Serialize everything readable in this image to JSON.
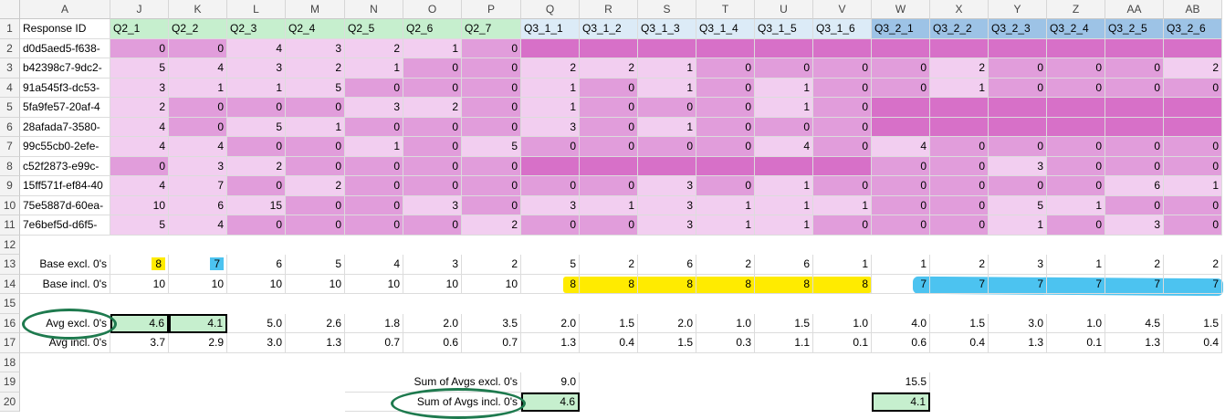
{
  "colors": {
    "q2_header": "#c6efce",
    "q31_header": "#dcebf7",
    "q32_header": "#9dc3e6",
    "light": "#f2cef0",
    "mid": "#e19ddb",
    "dark": "#d770c8",
    "yellow": "#ffeb00",
    "blue": "#4cc3f0",
    "green_fill": "#c6efce",
    "oval": "#1e7a4e"
  },
  "column_letters": [
    "A",
    "J",
    "K",
    "L",
    "M",
    "N",
    "O",
    "P",
    "Q",
    "R",
    "S",
    "T",
    "U",
    "V",
    "W",
    "X",
    "Y",
    "Z",
    "AA",
    "AB"
  ],
  "header_row": [
    "Response ID",
    "Q2_1",
    "Q2_2",
    "Q2_3",
    "Q2_4",
    "Q2_5",
    "Q2_6",
    "Q2_7",
    "Q3_1_1",
    "Q3_1_2",
    "Q3_1_3",
    "Q3_1_4",
    "Q3_1_5",
    "Q3_1_6",
    "Q3_2_1",
    "Q3_2_2",
    "Q3_2_3",
    "Q3_2_4",
    "Q3_2_5",
    "Q3_2_6"
  ],
  "data_rows": [
    {
      "id": "d0d5aed5-f638-",
      "vals": [
        "0",
        "0",
        "4",
        "3",
        "2",
        "1",
        "0",
        "",
        "",
        "",
        "",
        "",
        "",
        "",
        "",
        "",
        "",
        "",
        ""
      ]
    },
    {
      "id": "b42398c7-9dc2-",
      "vals": [
        "5",
        "4",
        "3",
        "2",
        "1",
        "0",
        "0",
        "2",
        "2",
        "1",
        "0",
        "0",
        "0",
        "0",
        "2",
        "0",
        "0",
        "0",
        "2"
      ]
    },
    {
      "id": "91a545f3-dc53-",
      "vals": [
        "3",
        "1",
        "1",
        "5",
        "0",
        "0",
        "0",
        "1",
        "0",
        "1",
        "0",
        "1",
        "0",
        "0",
        "1",
        "0",
        "0",
        "0",
        "0"
      ]
    },
    {
      "id": "5fa9fe57-20af-4",
      "vals": [
        "2",
        "0",
        "0",
        "0",
        "3",
        "2",
        "0",
        "1",
        "0",
        "0",
        "0",
        "1",
        "0",
        "",
        "",
        "",
        "",
        "",
        ""
      ]
    },
    {
      "id": "28afada7-3580-",
      "vals": [
        "4",
        "0",
        "5",
        "1",
        "0",
        "0",
        "0",
        "3",
        "0",
        "1",
        "0",
        "0",
        "0",
        "",
        "",
        "",
        "",
        "",
        ""
      ]
    },
    {
      "id": "99c55cb0-2efe-",
      "vals": [
        "4",
        "4",
        "0",
        "0",
        "1",
        "0",
        "5",
        "0",
        "0",
        "0",
        "0",
        "4",
        "0",
        "4",
        "0",
        "0",
        "0",
        "0",
        "0"
      ]
    },
    {
      "id": "c52f2873-e99c-",
      "vals": [
        "0",
        "3",
        "2",
        "0",
        "0",
        "0",
        "0",
        "",
        "",
        "",
        "",
        "",
        "",
        "0",
        "0",
        "3",
        "0",
        "0",
        "0"
      ]
    },
    {
      "id": "15ff571f-ef84-40",
      "vals": [
        "4",
        "7",
        "0",
        "2",
        "0",
        "0",
        "0",
        "0",
        "0",
        "3",
        "0",
        "1",
        "0",
        "0",
        "0",
        "0",
        "0",
        "6",
        "1"
      ]
    },
    {
      "id": "75e5887d-60ea-",
      "vals": [
        "10",
        "6",
        "15",
        "0",
        "0",
        "3",
        "0",
        "3",
        "1",
        "3",
        "1",
        "1",
        "1",
        "0",
        "0",
        "5",
        "1",
        "0",
        "0"
      ]
    },
    {
      "id": "7e6bef5d-d6f5-",
      "vals": [
        "5",
        "4",
        "0",
        "0",
        "0",
        "0",
        "2",
        "0",
        "0",
        "3",
        "1",
        "1",
        "0",
        "0",
        "0",
        "1",
        "0",
        "3",
        "0"
      ]
    }
  ],
  "summary": {
    "base_excl_label": "Base excl. 0's",
    "base_excl": [
      "8",
      "7",
      "6",
      "5",
      "4",
      "3",
      "2",
      "5",
      "2",
      "6",
      "2",
      "6",
      "1",
      "1",
      "2",
      "3",
      "1",
      "2",
      "2"
    ],
    "base_incl_label": "Base incl. 0's",
    "base_incl": [
      "10",
      "10",
      "10",
      "10",
      "10",
      "10",
      "10",
      "8",
      "8",
      "8",
      "8",
      "8",
      "8",
      "7",
      "7",
      "7",
      "7",
      "7",
      "7"
    ],
    "avg_excl_label": "Avg excl. 0's",
    "avg_excl": [
      "4.6",
      "4.1",
      "5.0",
      "2.6",
      "1.8",
      "2.0",
      "3.5",
      "2.0",
      "1.5",
      "2.0",
      "1.0",
      "1.5",
      "1.0",
      "4.0",
      "1.5",
      "3.0",
      "1.0",
      "4.5",
      "1.5"
    ],
    "avg_incl_label": "Avg incl. 0's",
    "avg_incl": [
      "3.7",
      "2.9",
      "3.0",
      "1.3",
      "0.7",
      "0.6",
      "0.7",
      "1.3",
      "0.4",
      "1.5",
      "0.3",
      "1.1",
      "0.1",
      "0.6",
      "0.4",
      "1.3",
      "0.1",
      "1.3",
      "0.4"
    ],
    "sum_excl_label": "Sum of Avgs excl. 0's",
    "sum_excl_q31": "9.0",
    "sum_excl_q32": "15.5",
    "sum_incl_label": "Sum of Avgs incl. 0's",
    "sum_incl_q31": "4.6",
    "sum_incl_q32": "4.1"
  }
}
